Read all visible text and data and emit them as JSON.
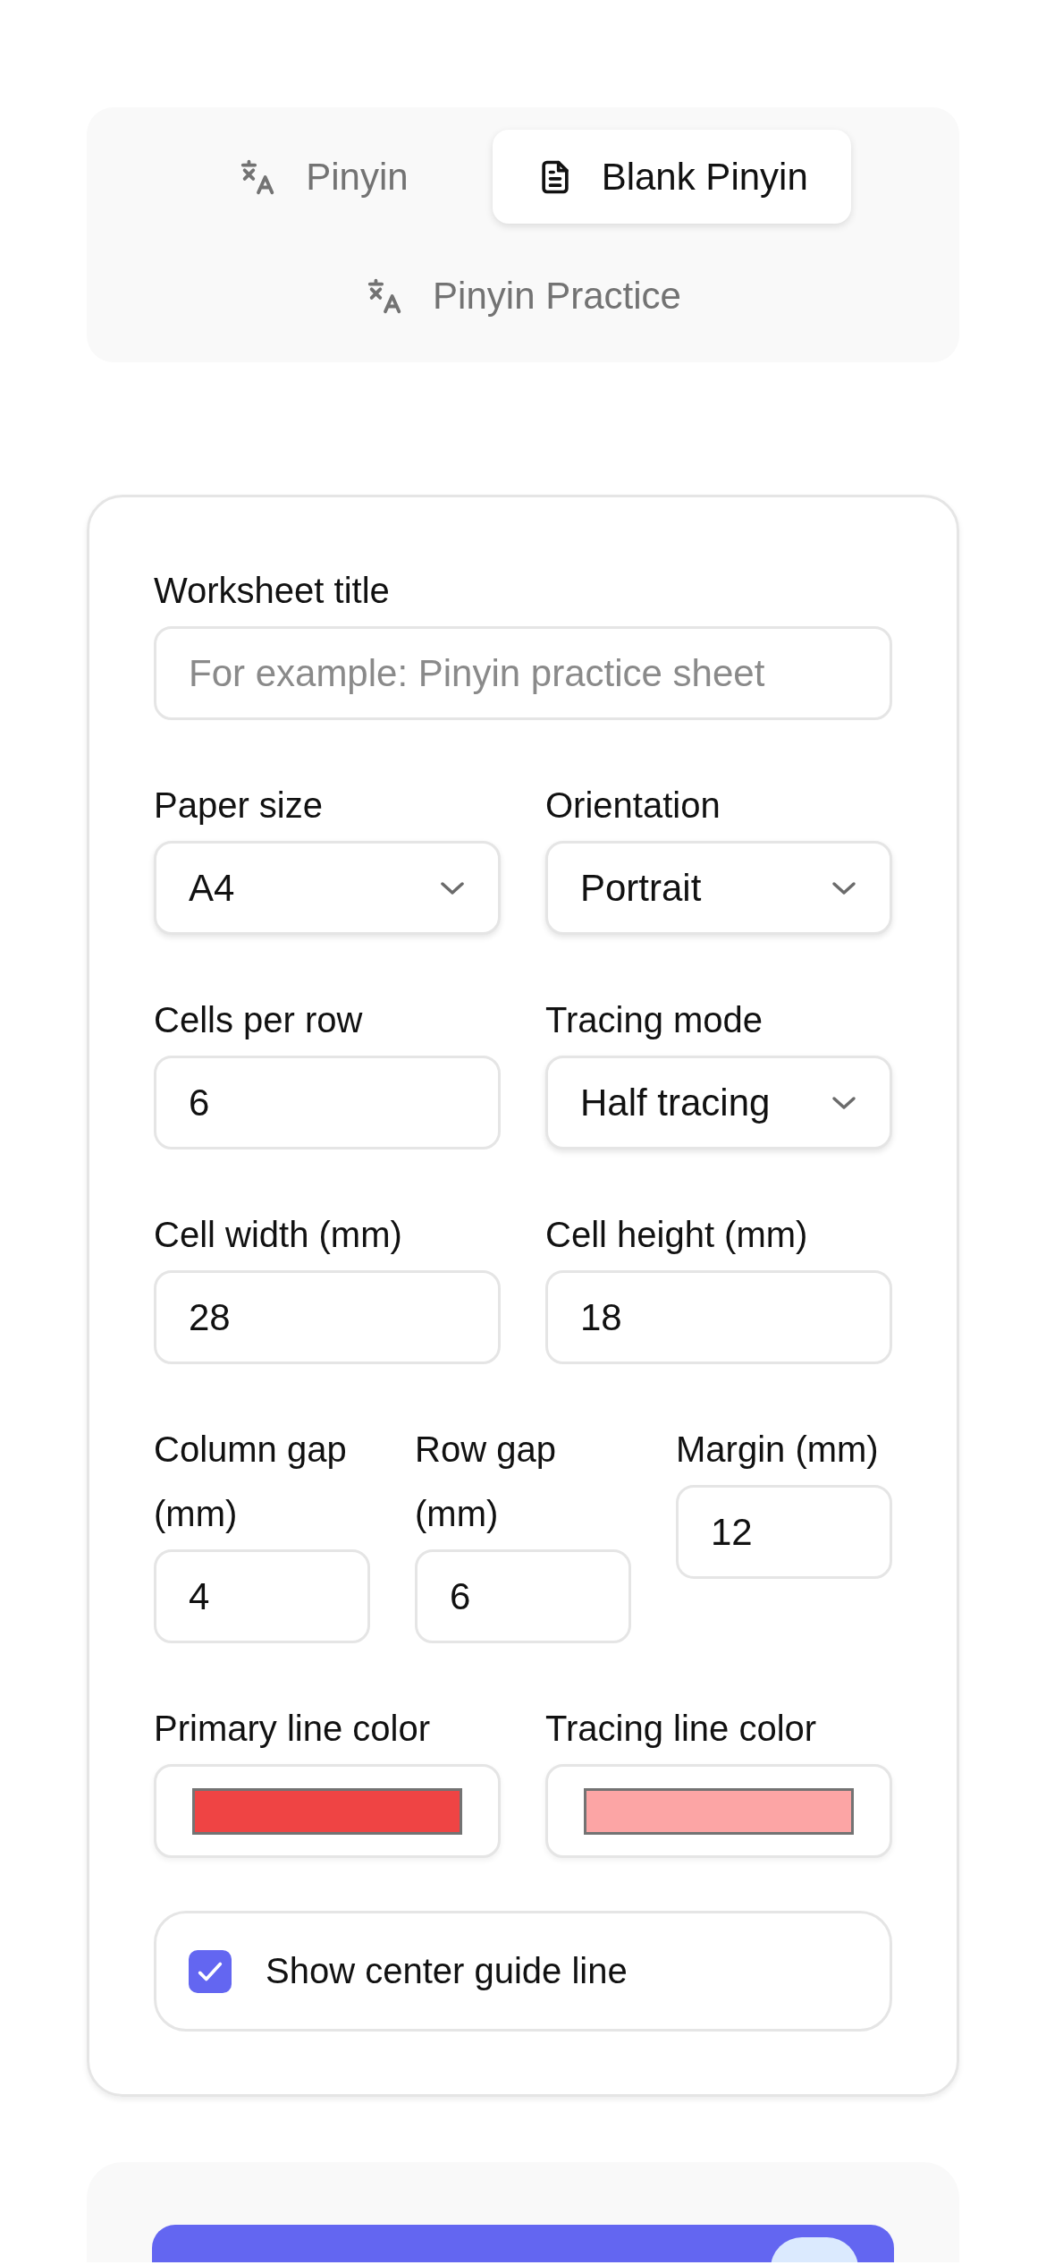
{
  "tabs": [
    {
      "label": "Pinyin",
      "kind": "translate",
      "selected": false
    },
    {
      "label": "Blank Pinyin",
      "kind": "document",
      "selected": true
    },
    {
      "label": "Pinyin Practice",
      "kind": "translate",
      "selected": false
    }
  ],
  "form": {
    "rows": [
      {
        "fields": [
          {
            "kind": "text",
            "label": "Worksheet title",
            "placeholder": "For example: Pinyin practice sheet"
          }
        ]
      },
      {
        "fields": [
          {
            "kind": "select",
            "label": "Paper size",
            "value": "A4"
          },
          {
            "kind": "select",
            "label": "Orientation",
            "value": "Portrait"
          }
        ]
      },
      {
        "fields": [
          {
            "kind": "number",
            "label": "Cells per row",
            "value": "6"
          },
          {
            "kind": "select",
            "label": "Tracing mode",
            "value": "Half tracing"
          }
        ]
      },
      {
        "fields": [
          {
            "kind": "number",
            "label": "Cell width (mm)",
            "value": "28"
          },
          {
            "kind": "number",
            "label": "Cell height (mm)",
            "value": "18"
          }
        ]
      },
      {
        "fields": [
          {
            "kind": "number",
            "label": "Column gap (mm)",
            "value": "4"
          },
          {
            "kind": "number",
            "label": "Row gap (mm)",
            "value": "6"
          },
          {
            "kind": "number",
            "label": "Margin (mm)",
            "value": "12"
          }
        ]
      },
      {
        "fields": [
          {
            "kind": "color",
            "label": "Primary line color",
            "color": "#ef4444"
          },
          {
            "kind": "color",
            "label": "Tracing line color",
            "color": "#fca5a5"
          }
        ]
      }
    ],
    "guide_line": {
      "label": "Show center guide line",
      "checked": true
    }
  }
}
